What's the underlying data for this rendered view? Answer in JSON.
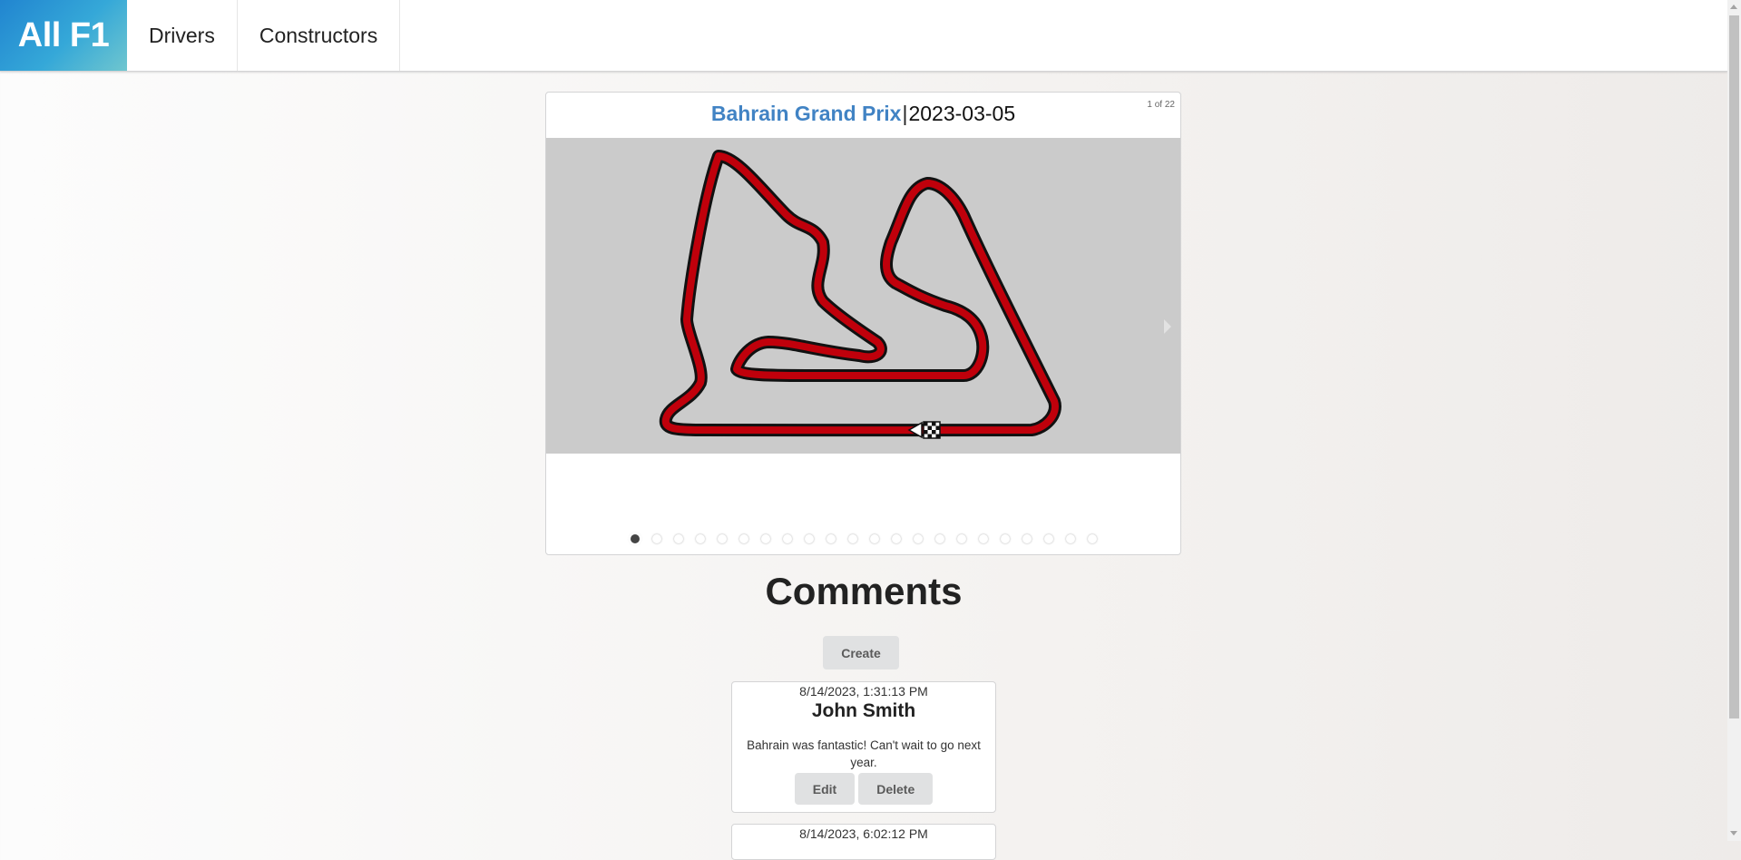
{
  "nav": {
    "brand": "All F1",
    "items": [
      {
        "label": "Drivers"
      },
      {
        "label": "Constructors"
      }
    ]
  },
  "race": {
    "name": "Bahrain Grand Prix",
    "separator": "|",
    "date": "2023-03-05",
    "slide_counter": "1 of 22",
    "slides_total": 22,
    "active_slide": 1,
    "track_color": "#c0000b",
    "track_background": "#cbcbcb"
  },
  "comments": {
    "title": "Comments",
    "create_label": "Create",
    "items": [
      {
        "timestamp": "8/14/2023, 1:31:13 PM",
        "author": "John Smith",
        "text": "Bahrain was fantastic! Can't wait to go next year.",
        "edit_label": "Edit",
        "delete_label": "Delete"
      },
      {
        "timestamp": "8/14/2023, 6:02:12 PM"
      }
    ]
  },
  "colors": {
    "brand_gradient_start": "#2185d0",
    "brand_gradient_end": "#6fc6cf",
    "link": "#4183c4",
    "button_bg": "#e0e1e2"
  }
}
